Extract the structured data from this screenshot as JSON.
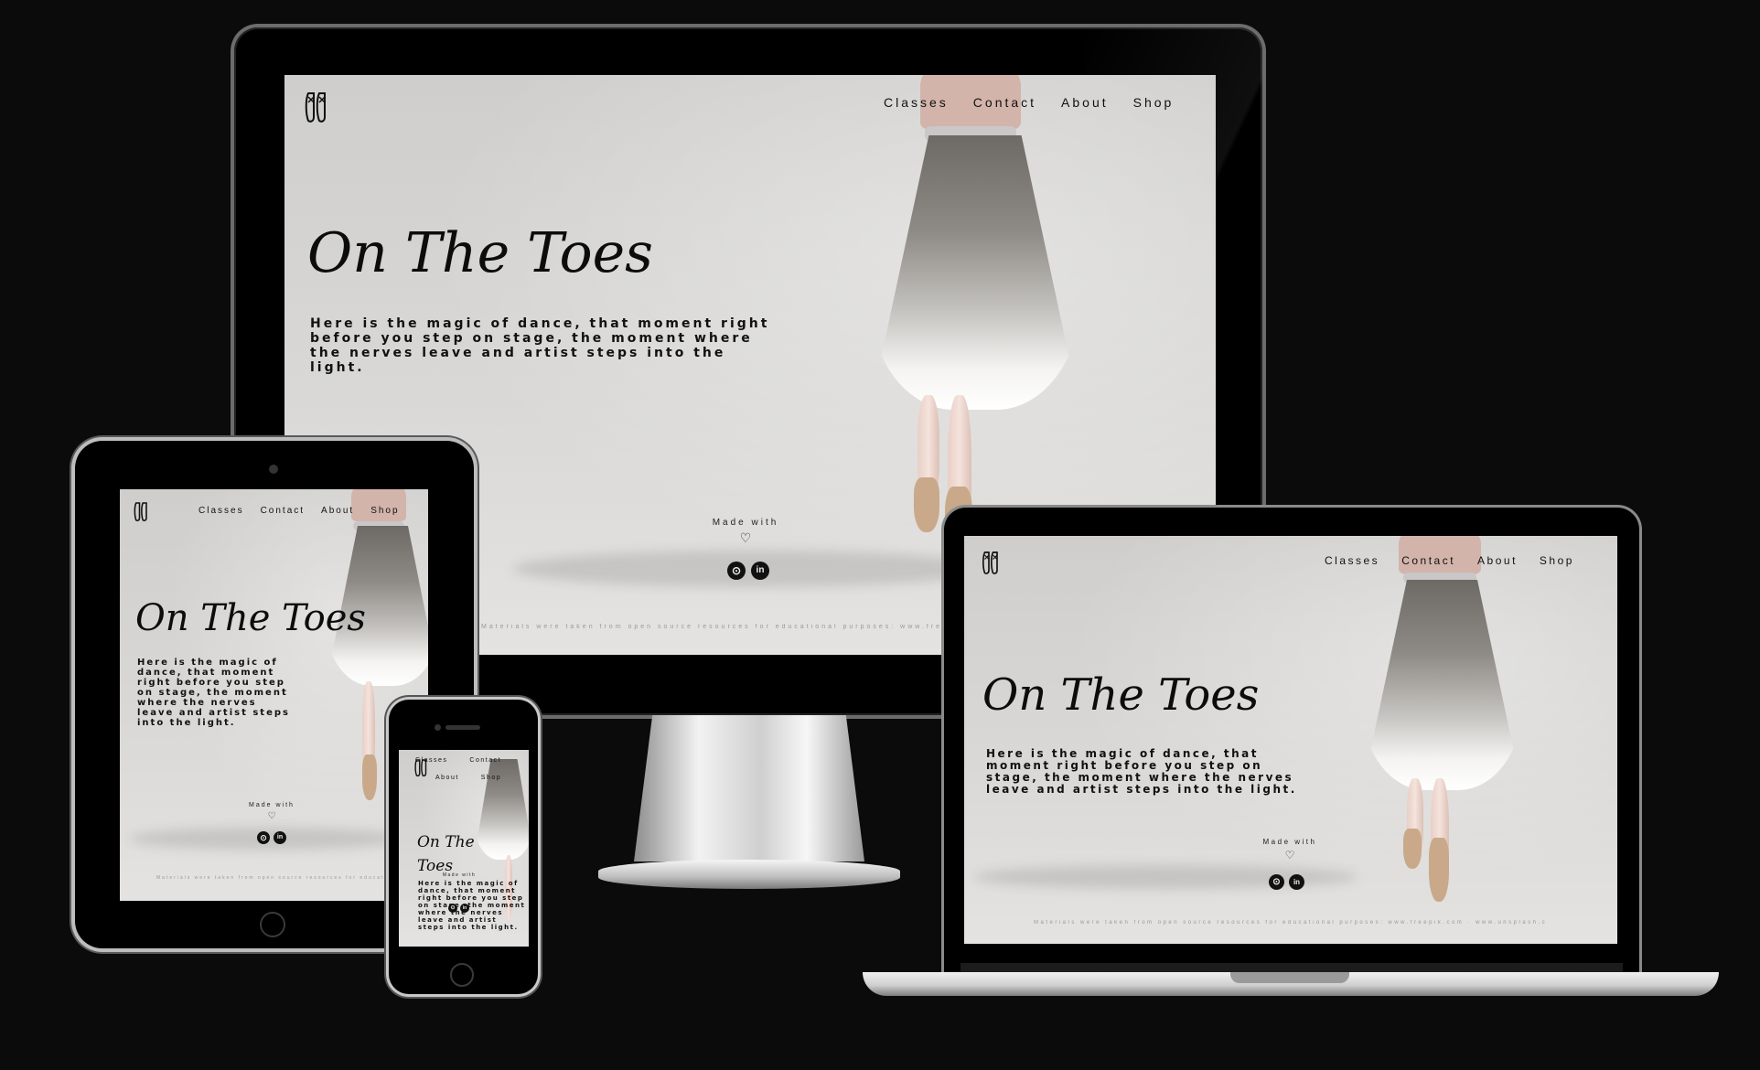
{
  "site": {
    "nav": [
      "Classes",
      "Contact",
      "About",
      "Shop"
    ],
    "title": "On The Toes",
    "description": "Here is the magic of dance, that moment right before you step on stage, the moment where the nerves leave and artist steps into the light.",
    "made_with": "Made with",
    "heart": "♡",
    "social": [
      "github-icon",
      "linkedin-icon"
    ],
    "social_glyphs": [
      "⊙",
      "in"
    ],
    "credit": "Materials were taken from open source resources for educational purposes: www.freepik.com · www.unsplash.com · www.pexels.com"
  },
  "devices": [
    "desktop-monitor",
    "tablet",
    "smartphone",
    "laptop"
  ]
}
